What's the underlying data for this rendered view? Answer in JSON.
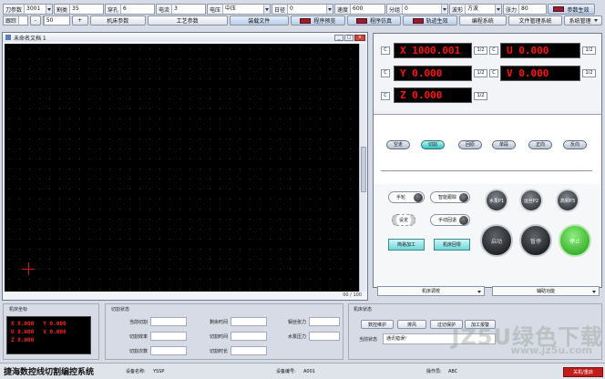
{
  "params": [
    {
      "label": "刀参数",
      "value": "3001",
      "dd": true
    },
    {
      "label": "割类",
      "value": "35"
    },
    {
      "label": "穿孔",
      "value": "6"
    },
    {
      "label": "电流",
      "value": "3"
    },
    {
      "label": "电压",
      "value": "中压",
      "dd": true
    },
    {
      "label": "日径",
      "value": "0",
      "dd": true
    },
    {
      "label": "速度",
      "value": "600"
    },
    {
      "label": "分组",
      "value": "0",
      "dd": true
    },
    {
      "label": "波形",
      "value": "方波",
      "dd": true
    },
    {
      "label": "张力",
      "value": "80"
    },
    {
      "label": "",
      "value": "参数生效",
      "flag": true
    }
  ],
  "row2": {
    "spacing_label": "跟踪",
    "spacing_value": "50",
    "minus": "-",
    "plus": "+",
    "buttons": [
      "机床参数",
      "工艺参数",
      "装载文件",
      "程序预览",
      "程序仿真",
      "轨迹生效",
      "编程系统",
      "文件管理系统",
      "系统管理"
    ]
  },
  "canvas": {
    "title": "未命名文档 1",
    "status": "00 / 100"
  },
  "coords": {
    "x": "X 1000.001",
    "y": "Y 0.000",
    "z": "Z 0.000",
    "u": "U 0.000",
    "v": "V 0.000",
    "clear": "C",
    "half": "1/2"
  },
  "modes": [
    "空走",
    "切割",
    "回原",
    "单段",
    "正向",
    "反向"
  ],
  "ctrl": {
    "manual": "手轮",
    "auto_follow": "智能跟踪",
    "wire_in": "手动回退",
    "setting": "设定",
    "water_left": "水泵P1",
    "water_mid": "运丝P2",
    "water_right": "高频P3",
    "simple_proc": "简易加工",
    "machine_proc": "机床回零",
    "start": "启动",
    "pause": "暂停",
    "stop": "停止",
    "combo_left": "机床调校",
    "combo_right": "辅助功能"
  },
  "bottom": {
    "machine_coords_title": "机床坐标",
    "mini": {
      "x": "X 0.000",
      "y": "Y 0.000",
      "u": "U 0.000",
      "v": "V 0.000",
      "z": "Z 0.000"
    },
    "cut_status_title": "切割状态",
    "fields_col1": [
      "当前切割",
      "切割效率",
      "切割次数"
    ],
    "fields_col2": [
      "剩余时间",
      "切割时间",
      "切割时长"
    ],
    "fields_col3": [
      "钼丝张力",
      "水泵压力"
    ],
    "machine_status_title": "机床状态",
    "btn_maintain": "数控维护",
    "btn_vent": "排风",
    "btn_pump": "过切保护",
    "btn_extra": "加工报警",
    "current_state_label": "当前状态",
    "current_state_value": "通讯错误!"
  },
  "footer": {
    "title": "捷海数控线切割编控系统",
    "dev_label": "设备名称:",
    "dev_value": "YSSP",
    "id_label": "设备编号:",
    "id_value": "A001",
    "op_label": "操作员:",
    "op_value": "ABC",
    "exit": "关机/重启"
  },
  "watermark": {
    "main": "JZ5U绿色下载",
    "sub": "www.jz5u.com"
  }
}
